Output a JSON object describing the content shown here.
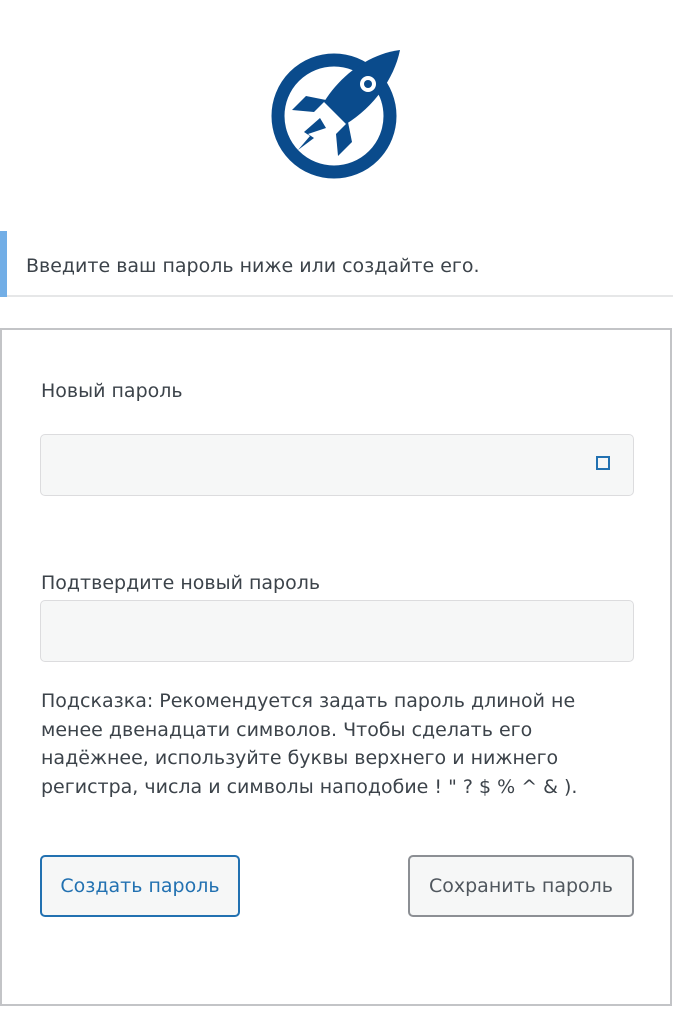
{
  "logo": {
    "icon": "rocket-logo-icon",
    "color": "#0a4b8c"
  },
  "notice": {
    "text": "Введите ваш пароль ниже или создайте его.",
    "accent_color": "#72aee6"
  },
  "form": {
    "new_password_label": "Новый пароль",
    "new_password_value": "",
    "toggle_icon": "show-password-icon",
    "confirm_password_label": "Подтвердите новый пароль",
    "confirm_password_value": "",
    "hint": "Подсказка: Рекомендуется задать пароль длиной не менее двенадцати символов. Чтобы сделать его надёжнее, используйте буквы верхнего и нижнего регистра, числа и символы наподобие ! \" ? $ % ^ & )."
  },
  "buttons": {
    "generate_label": "Создать пароль",
    "save_label": "Сохранить пароль"
  },
  "colors": {
    "primary": "#2271b1",
    "text": "#3c434a",
    "border": "#c3c4c7"
  }
}
